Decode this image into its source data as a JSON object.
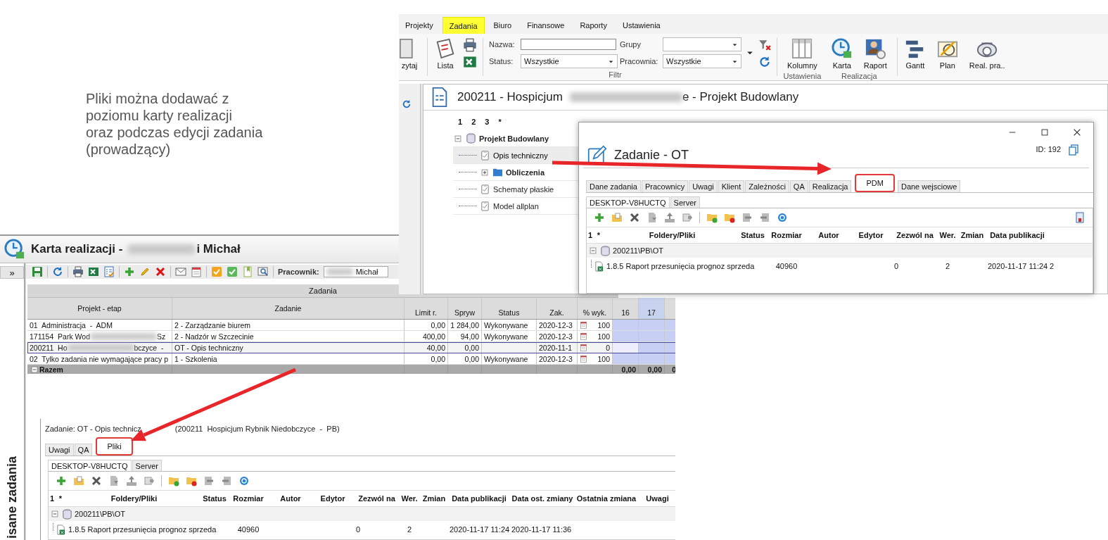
{
  "slide_note": {
    "lines": [
      "Pliki można dodawać z",
      "poziomu karty realizacji",
      "oraz podczas edycji zadania",
      "(prowadzący)"
    ]
  },
  "projects_window": {
    "menu_tabs": [
      {
        "label": "Projekty",
        "selected": false,
        "highlighted": false
      },
      {
        "label": "Zadania",
        "selected": true,
        "highlighted": true
      },
      {
        "label": "Biuro",
        "selected": false,
        "highlighted": false
      },
      {
        "label": "Finansowe",
        "selected": false,
        "highlighted": false
      },
      {
        "label": "Raporty",
        "selected": false,
        "highlighted": false
      },
      {
        "label": "Ustawienia",
        "selected": false,
        "highlighted": false
      }
    ],
    "ribbon": {
      "cut_button": "zytaj",
      "list_button": "Lista",
      "filter": {
        "name_label": "Nazwa:",
        "groups_label": "Grupy",
        "status_label": "Status:",
        "status_value": "Wszystkie",
        "workshop_label": "Pracownia:",
        "workshop_value": "Wszystkie",
        "group_label": "Filtr"
      },
      "settings_group": {
        "label": "Ustawienia",
        "buttons": [
          "Kolumny"
        ]
      },
      "realization_group": {
        "label": "Realizacja",
        "buttons": [
          "Karta",
          "Raport"
        ]
      },
      "view_buttons": [
        "Gantt",
        "Plan",
        "Real. pra.."
      ]
    },
    "title": {
      "before": "200211 - Hospicjum",
      "after": "e - Projekt Budowlany"
    },
    "outline_levels": [
      "1",
      "2",
      "3",
      "*"
    ],
    "tree": [
      {
        "label": "Projekt Budowlany",
        "kind": "database",
        "expanded": true,
        "selected": false,
        "children": [
          {
            "label": "Opis techniczny",
            "kind": "task",
            "selected": true
          },
          {
            "label": "Obliczenia",
            "kind": "folder",
            "expanded": false,
            "selected": false
          },
          {
            "label": "Schematy płaskie",
            "kind": "task",
            "selected": false
          },
          {
            "label": "Model allplan",
            "kind": "task",
            "selected": false
          }
        ]
      }
    ]
  },
  "task_dialog": {
    "title": "Zadanie - OT",
    "id": "ID: 192",
    "tabs": [
      {
        "label": "Dane zadania",
        "selected": false,
        "highlighted": false
      },
      {
        "label": "Pracownicy",
        "selected": false,
        "highlighted": false
      },
      {
        "label": "Uwagi",
        "selected": false,
        "highlighted": false
      },
      {
        "label": "Klient",
        "selected": false,
        "highlighted": false
      },
      {
        "label": "Zależności",
        "selected": false,
        "highlighted": false
      },
      {
        "label": "QA",
        "selected": false,
        "highlighted": false
      },
      {
        "label": "Realizacja",
        "selected": false,
        "highlighted": false
      },
      {
        "label": "PDM",
        "selected": true,
        "highlighted": true
      },
      {
        "label": "Dane wejsciowe",
        "selected": false,
        "highlighted": false
      }
    ],
    "files": {
      "subtabs": [
        {
          "label": "DESKTOP-V8HUCTQ",
          "selected": true
        },
        {
          "label": "Server",
          "selected": false
        }
      ],
      "columns": [
        "1",
        "*",
        "Foldery/Pliki",
        "Status",
        "Rozmiar",
        "Autor",
        "Edytor",
        "Zezwól na",
        "Wer.",
        "Zmian",
        "Data publikacji"
      ],
      "folders": [
        {
          "label": "200211\\PB\\OT",
          "expanded": true,
          "files": [
            {
              "name": "1.8.5 Raport przesunięcia prognoz sprzeda",
              "size": "40960",
              "permit": "0",
              "version": "2",
              "published": "2020-11-17 11:24",
              "modified": "2"
            }
          ]
        }
      ]
    }
  },
  "realization_window": {
    "title": {
      "before": "Karta realizacji -",
      "after": "i Michał"
    },
    "collapse_button": "»",
    "side_label": "isane zadania",
    "employee_label": "Pracownik:",
    "employee_value": "Michał",
    "grid": {
      "group_header": "Zadania",
      "columns": [
        "Projekt - etap",
        "Zadanie",
        "Limit r.",
        "Spryw",
        "Status",
        "Zak.",
        "% wyk.",
        "16",
        "17"
      ],
      "rows": [
        {
          "selected": false,
          "project": {
            "before": "01  Administracja  -  ADM"
          },
          "task": "2 - Zarządzanie biurem",
          "limit": "0,00",
          "spent": "1 284,00",
          "status": "Wykonywane",
          "due": "2020-12-3",
          "pct": "100"
        },
        {
          "selected": false,
          "project": {
            "before": "171154  Park Wod",
            "after": "Sz"
          },
          "task": "2 - Nadzór w Szczecinie",
          "limit": "400,00",
          "spent": "94,00",
          "status": "Wykonywane",
          "due": "2020-12-3",
          "pct": "100"
        },
        {
          "selected": true,
          "project": {
            "before": "200211  Ho",
            "after": "bczyce  -"
          },
          "task": "OT - Opis techniczny",
          "limit": "40,00",
          "spent": "0,00",
          "due": "2020-11-1",
          "pct": "0"
        },
        {
          "selected": false,
          "project": {
            "before": "02  Tylko zadania nie wymagające pracy p"
          },
          "task": "1 - Szkolenia",
          "limit": "0,00",
          "spent": "0,00",
          "status": "Wykonywane",
          "due": "2020-12-3",
          "pct": "100"
        }
      ],
      "total": {
        "label": "Razem",
        "expanded": true,
        "d16": "0,00",
        "d17": "0,00",
        "column_10": "0"
      }
    },
    "task_panel": {
      "caption_start": "Zadanie: OT - Opis technicz",
      "caption_end": "(200211  Hospicjum Rybnik Niedobczyce  -  PB)",
      "tabs": [
        {
          "label": "Uwagi",
          "selected": false,
          "highlighted": false
        },
        {
          "label": "QA",
          "selected": false,
          "highlighted": false
        },
        {
          "label": "Pliki",
          "selected": true,
          "highlighted": true
        }
      ],
      "files": {
        "subtabs": [
          {
            "label": "DESKTOP-V8HUCTQ",
            "selected": true
          },
          {
            "label": "Server",
            "selected": false
          }
        ],
        "columns": [
          "1",
          "*",
          "Foldery/Pliki",
          "Status",
          "Rozmiar",
          "Autor",
          "Edytor",
          "Zezwól na",
          "Wer.",
          "Zmian",
          "Data publikacji",
          "Data ost. zmiany",
          "Ostatnia zmiana",
          "Uwagi"
        ],
        "folders": [
          {
            "label": "200211\\PB\\OT",
            "expanded": true,
            "files": [
              {
                "name": "1.8.5 Raport przesunięcia prognoz sprzeda",
                "size": "40960",
                "permit": "0",
                "version": "2",
                "published": "2020-11-17 11:24",
                "modified": "2020-11-17 11:36"
              }
            ]
          }
        ]
      }
    }
  }
}
